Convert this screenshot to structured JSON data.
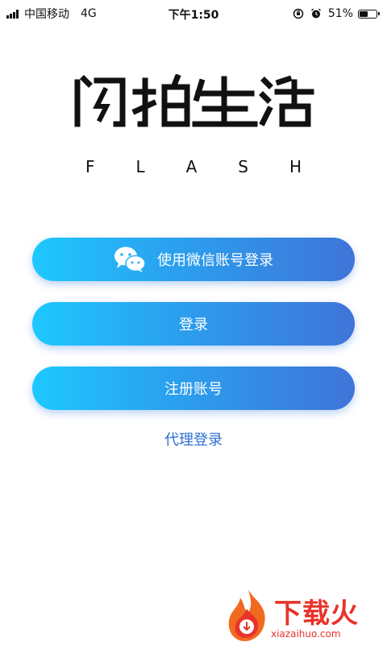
{
  "status_bar": {
    "carrier": "中国移动",
    "network": "4G",
    "time": "下午1:50",
    "battery_percent": "51%",
    "battery_level": 0.51
  },
  "logo": {
    "title": "闪拍生活",
    "subtitle_letters": [
      "F",
      "L",
      "A",
      "S",
      "H"
    ]
  },
  "actions": {
    "wechat_login_label": "使用微信账号登录",
    "login_label": "登录",
    "register_label": "注册账号",
    "agent_login_label": "代理登录"
  },
  "watermark": {
    "brand": "下载火",
    "url": "xiazaihuo.com"
  },
  "colors": {
    "button_start": "#1ec8ff",
    "button_end": "#3f74d8",
    "link": "#2c6fd0",
    "watermark": "#e8342a"
  }
}
